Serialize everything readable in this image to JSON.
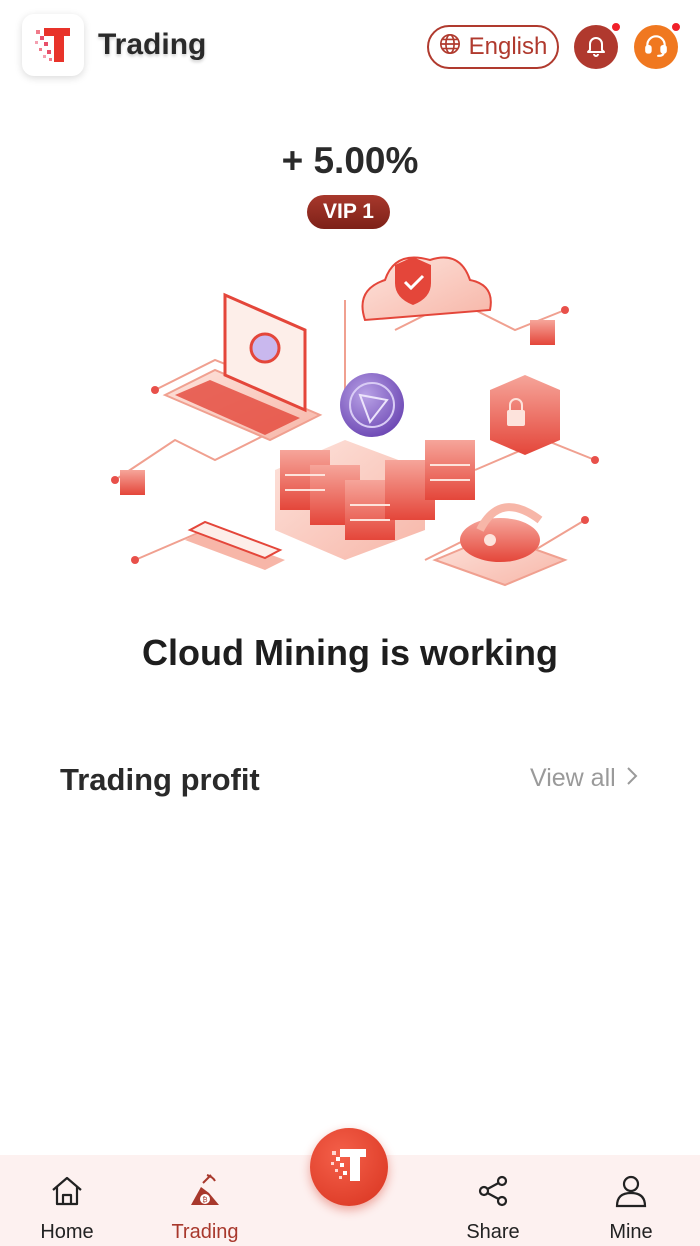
{
  "header": {
    "title": "Trading",
    "language_label": "English",
    "logo_icon": "brand-t-logo",
    "globe_icon": "globe-icon",
    "bell_icon": "bell-icon",
    "support_icon": "headset-icon",
    "colors": {
      "accent": "#b03a2e",
      "support": "#f07820",
      "badge_dot": "#f0202a"
    }
  },
  "main": {
    "rate": "+ 5.00%",
    "vip_label": "VIP 1",
    "status": "Cloud Mining is working",
    "illustration_icon": "cloud-mining-illustration"
  },
  "profit": {
    "title": "Trading profit",
    "view_all": "View all"
  },
  "nav": {
    "items": [
      {
        "label": "Home",
        "icon": "home-icon"
      },
      {
        "label": "Trading",
        "icon": "mining-icon",
        "active": true
      },
      {
        "label": "Share",
        "icon": "share-icon"
      },
      {
        "label": "Mine",
        "icon": "user-icon"
      }
    ],
    "center_icon": "brand-t-logo",
    "colors": {
      "background": "#fdf1f0",
      "active": "#a8382c"
    }
  }
}
